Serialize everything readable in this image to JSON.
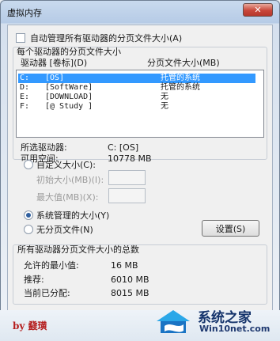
{
  "window": {
    "title": "虚拟内存",
    "close_glyph": "✕"
  },
  "auto_manage": {
    "label": "自动管理所有驱动器的分页文件大小(A)",
    "checked": false
  },
  "per_drive": {
    "heading": "每个驱动器的分页文件大小",
    "col_drive": "驱动器 [卷标](D)",
    "col_size": "分页文件大小(MB)",
    "drives": [
      {
        "drive": "C:",
        "label": "[OS]",
        "size": "托管的系统",
        "selected": true
      },
      {
        "drive": "D:",
        "label": "[SoftWare]",
        "size": "托管的系统",
        "selected": false
      },
      {
        "drive": "E:",
        "label": "[DOWNLOAD]",
        "size": "无",
        "selected": false
      },
      {
        "drive": "F:",
        "label": "[@ Study ]",
        "size": "无",
        "selected": false
      }
    ],
    "selected_drive_label": "所选驱动器:",
    "selected_drive_value": "C:  [OS]",
    "free_space_label": "可用空间:",
    "free_space_value": "10778 MB"
  },
  "options": {
    "custom_size": "自定义大小(C):",
    "initial_size": "初始大小(MB)(I):",
    "max_size": "最大值(MB)(X):",
    "system_managed": "系统管理的大小(Y)",
    "no_paging": "无分页文件(N)",
    "selected_option": "system_managed"
  },
  "set_button": "设置(S)",
  "totals": {
    "heading": "所有驱动器分页文件大小的总数",
    "min_label": "允许的最小值:",
    "min_value": "16 MB",
    "recommended_label": "推荐:",
    "recommended_value": "6010 MB",
    "allocated_label": "当前已分配:",
    "allocated_value": "8015 MB"
  },
  "footer": {
    "signature": "by 鼗璜",
    "watermark_title": "系统之家",
    "watermark_site": "Win10net.com"
  },
  "colors": {
    "selection": "#3399ff",
    "close_button": "#c9473a",
    "signature": "#b51d1d"
  }
}
